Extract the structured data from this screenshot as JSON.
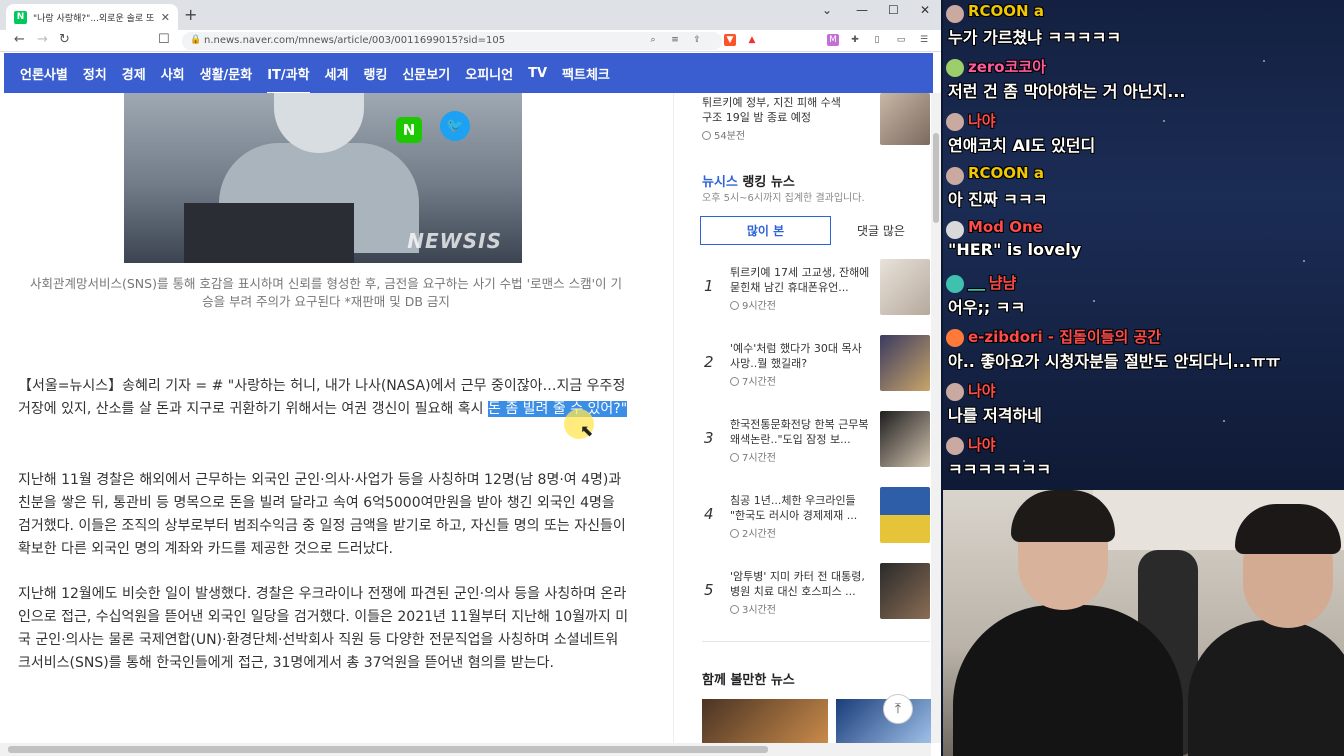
{
  "browser": {
    "tab_title": "\"나랑 사랑해?\"...외로운 솔로 또 \"",
    "url": "n.news.naver.com/mnews/article/003/0011699015?sid=105"
  },
  "nav": {
    "items": [
      "언론사별",
      "정치",
      "경제",
      "사회",
      "생활/문화",
      "IT/과학",
      "세계",
      "랭킹",
      "신문보기",
      "오피니언",
      "TV",
      "팩트체크"
    ],
    "active": "IT/과학"
  },
  "article": {
    "photo_watermark": "NEWSIS",
    "caption": "사회관계망서비스(SNS)를 통해 호감을 표시하며 신뢰를 형성한 후, 금전을 요구하는 사기 수법 '로맨스 스캠'이 기승을 부려 주의가 요구된다 *재판매 및 DB 금지",
    "p1_text": "【서울=뉴시스】송혜리 기자 = # \"사랑하는 허니, 내가 나사(NASA)에서 근무 중이잖아…지금 우주정거장에 있지, 산소를 살 돈과 지구로 귀환하기 위해서는 여권 갱신이 필요해 혹시 ",
    "p1_highlight": "돈 좀 빌려 줄 수 있어?\"",
    "p2": "지난해 11월 경찰은 해외에서 근무하는 외국인 군인·의사·사업가 등을 사칭하며 12명(남 8명·여 4명)과 친분을 쌓은 뒤, 통관비 등 명목으로 돈을 빌려 달라고 속여 6억5000여만원을 받아 챙긴 외국인 4명을 검거했다. 이들은 조직의 상부로부터 범죄수익금 중 일정 금액을 받기로 하고, 자신들 명의 또는 자신들이 확보한 다른 외국인 명의 계좌와 카드를 제공한 것으로 드러났다.",
    "p3": "지난해 12월에도 비슷한 일이 발생했다. 경찰은 우크라이나 전쟁에 파견된 군인·의사 등을 사칭하며 온라인으로 접근, 수십억원을 뜯어낸 외국인 일당을 검거했다. 이들은 2021년 11월부터 지난해 10월까지 미국 군인·의사는 물론 국제연합(UN)·환경단체·선박회사 직원 등 다양한 전문직업을 사칭하며 소셜네트워크서비스(SNS)를 통해 한국인들에게 접근, 31명에게서 총 37억원을 뜯어낸 혐의를 받는다."
  },
  "sidebar": {
    "top_item": {
      "title": "튀르키예 정부, 지진 피해 수색구조 19일 밤 종료 예정",
      "time": "54분전"
    },
    "ranking_brand": "뉴시스",
    "ranking_title": "랭킹 뉴스",
    "ranking_subtitle": "오후 5시~6시까지 집계한 결과입니다.",
    "tab_most_viewed": "많이 본",
    "tab_most_commented": "댓글 많은",
    "ranking": [
      {
        "rank": "1",
        "title": "튀르키예 17세 고교생, 잔해에 묻힌채 남긴 휴대폰유언...",
        "time": "9시간전"
      },
      {
        "rank": "2",
        "title": "'예수'처럼 했다가 30대 목사 사망..뭘 했길래?",
        "time": "7시간전"
      },
      {
        "rank": "3",
        "title": "한국전통문화전당 한복 근무복 왜색논란..\"도입 잠정 보...",
        "time": "7시간전"
      },
      {
        "rank": "4",
        "title": "침공 1년...체한 우크라인들 \"한국도 러시아 경제제재 ...",
        "time": "2시간전"
      },
      {
        "rank": "5",
        "title": "'암투병' 지미 카터 전 대통령, 병원 치료 대신 호스피스 ...",
        "time": "3시간전"
      }
    ],
    "also_title": "함께 볼만한 뉴스"
  },
  "chat": {
    "messages": [
      {
        "nick": "RCOON a",
        "nick_color": "#f0c800",
        "text": "누가 가르쳤냐 ㅋㅋㅋㅋㅋ"
      },
      {
        "nick": "zero코코아",
        "nick_color": "#ff5aa0",
        "text": "저런 건 좀 막아야하는 거 아닌지..."
      },
      {
        "nick": "나야",
        "nick_color": "#ff4b4b",
        "text": "연애코치 AI도 있던디"
      },
      {
        "nick": "RCOON a",
        "nick_color": "#f0c800",
        "text": "아 진짜 ㅋㅋㅋ"
      },
      {
        "nick": "Mod One",
        "nick_color": "#ff4b4b",
        "text": "\"HER\" is lovely"
      },
      {
        "nick": "냠냠",
        "nick_color": "#ff4b4b",
        "text": "어우;; ㅋㅋ"
      },
      {
        "nick": "e-zibdori - 집돌이들의 공간",
        "nick_color": "#ff4b4b",
        "text": "아.. 좋아요가 시청자분들 절반도 안되다니...ㅠㅠ"
      },
      {
        "nick": "나야",
        "nick_color": "#ff4b4b",
        "text": "나를 저격하네"
      },
      {
        "nick": "나야",
        "nick_color": "#ff4b4b",
        "text": "ㅋㅋㅋㅋㅋㅋㅋ"
      }
    ]
  }
}
